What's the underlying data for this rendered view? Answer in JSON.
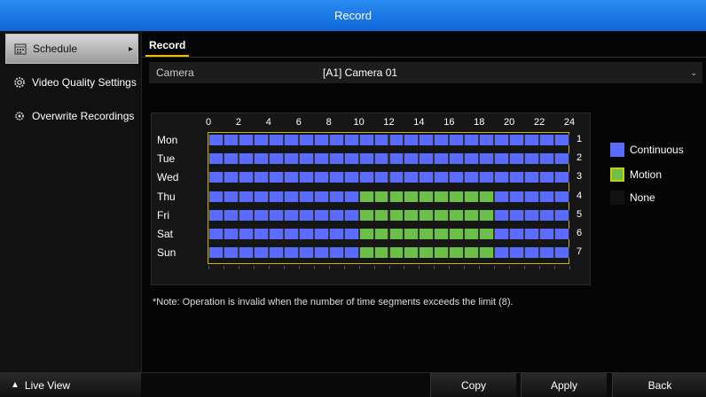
{
  "window": {
    "title": "Record"
  },
  "sidebar": {
    "items": [
      {
        "label": "Schedule",
        "icon": "calendar-icon",
        "active": true
      },
      {
        "label": "Video Quality Settings",
        "icon": "settings-gear-icon",
        "active": false
      },
      {
        "label": "Overwrite Recordings",
        "icon": "overwrite-gear-icon",
        "active": false
      }
    ]
  },
  "tab": {
    "label": "Record"
  },
  "camera": {
    "label": "Camera",
    "value": "[A1] Camera 01"
  },
  "schedule": {
    "hours": [
      "0",
      "2",
      "4",
      "6",
      "8",
      "10",
      "12",
      "14",
      "16",
      "18",
      "20",
      "22",
      "24"
    ],
    "days": [
      {
        "name": "Mon",
        "num": "1",
        "segments": [
          {
            "type": "continuous",
            "start": 0,
            "end": 24
          }
        ]
      },
      {
        "name": "Tue",
        "num": "2",
        "segments": [
          {
            "type": "continuous",
            "start": 0,
            "end": 24
          }
        ]
      },
      {
        "name": "Wed",
        "num": "3",
        "segments": [
          {
            "type": "continuous",
            "start": 0,
            "end": 24
          }
        ]
      },
      {
        "name": "Thu",
        "num": "4",
        "segments": [
          {
            "type": "continuous",
            "start": 0,
            "end": 10
          },
          {
            "type": "motion",
            "start": 10,
            "end": 19
          },
          {
            "type": "continuous",
            "start": 19,
            "end": 24
          }
        ]
      },
      {
        "name": "Fri",
        "num": "5",
        "segments": [
          {
            "type": "continuous",
            "start": 0,
            "end": 10
          },
          {
            "type": "motion",
            "start": 10,
            "end": 19
          },
          {
            "type": "continuous",
            "start": 19,
            "end": 24
          }
        ]
      },
      {
        "name": "Sat",
        "num": "6",
        "segments": [
          {
            "type": "continuous",
            "start": 0,
            "end": 10
          },
          {
            "type": "motion",
            "start": 10,
            "end": 19
          },
          {
            "type": "continuous",
            "start": 19,
            "end": 24
          }
        ]
      },
      {
        "name": "Sun",
        "num": "7",
        "segments": [
          {
            "type": "continuous",
            "start": 0,
            "end": 10
          },
          {
            "type": "motion",
            "start": 10,
            "end": 19
          },
          {
            "type": "continuous",
            "start": 19,
            "end": 24
          }
        ]
      }
    ]
  },
  "legend": {
    "continuous": {
      "label": "Continuous",
      "color": "#5a6cff"
    },
    "motion": {
      "label": "Motion",
      "color": "#6cc04a"
    },
    "none": {
      "label": "None",
      "color": "#111111"
    }
  },
  "note": "*Note: Operation is invalid when the number of time segments exceeds the limit (8).",
  "footer": {
    "live_view": "Live View",
    "copy": "Copy",
    "apply": "Apply",
    "back": "Back"
  },
  "colors": {
    "titlebar": "#1a7ae6",
    "highlight": "#ccb300"
  }
}
